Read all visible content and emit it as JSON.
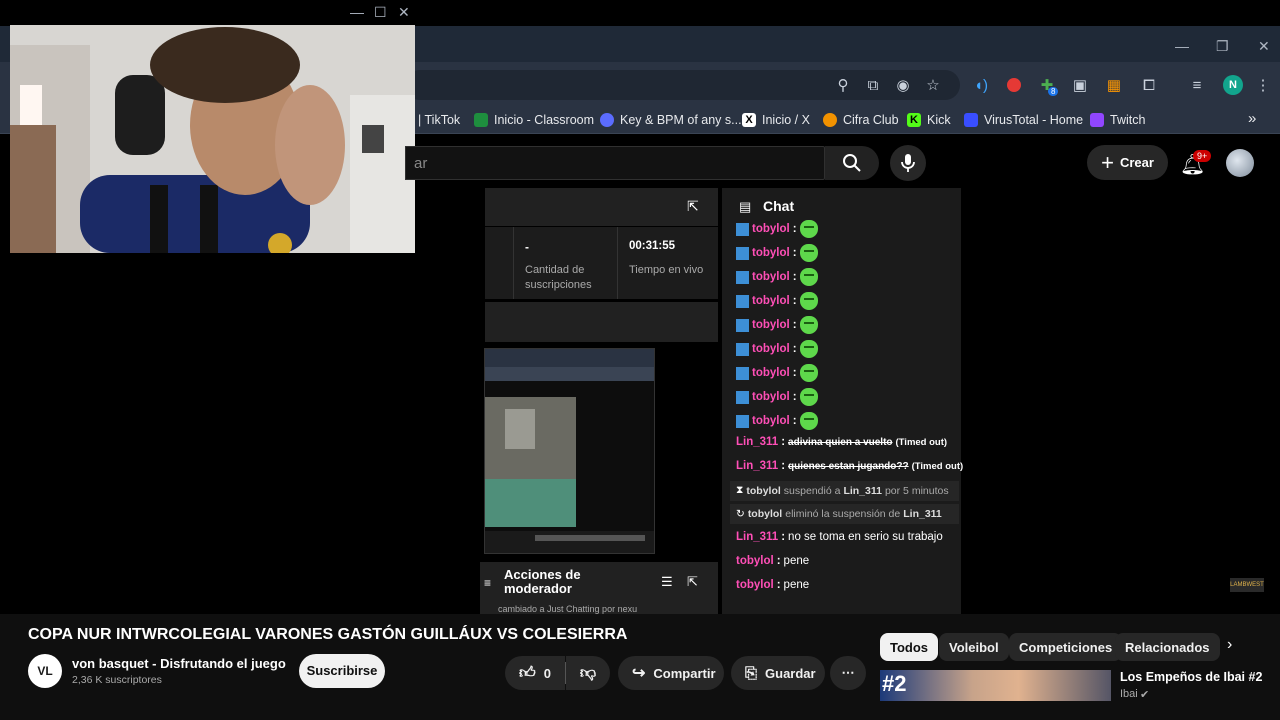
{
  "camera_window": {
    "minimize": "—",
    "maximize": "☐",
    "close": "✕"
  },
  "browser": {
    "window_controls": {
      "minimize": "—",
      "restore": "❐",
      "close": "✕"
    },
    "profile_initial": "N",
    "extension_badge": "8",
    "bookmarks": [
      {
        "label": "| TikTok",
        "color": "#ffffff00"
      },
      {
        "label": "Inicio - Classroom",
        "color": "#1e8e3e"
      },
      {
        "label": "Key & BPM of any s...",
        "color": "#5b6cff"
      },
      {
        "label": "Inicio / X",
        "color": "#000000"
      },
      {
        "label": "Cifra Club",
        "color": "#f29200"
      },
      {
        "label": "Kick",
        "color": "#53fc18"
      },
      {
        "label": "VirusTotal - Home",
        "color": "#394eff"
      },
      {
        "label": "Twitch",
        "color": "#9146ff"
      }
    ],
    "bookmarks_more": "»"
  },
  "youtube": {
    "search_placeholder": "ar",
    "create_label": "Crear",
    "notifications_badge": "9+"
  },
  "studio": {
    "subscriptions_value": "-",
    "subscriptions_label_line1": "Cantidad de",
    "subscriptions_label_line2": "suscripciones",
    "live_time_value": "00:31:55",
    "live_time_label": "Tiempo en vivo",
    "mod_actions_line1": "Acciones de",
    "mod_actions_line2": "moderador",
    "mod_actions_snippet": "cambiado a Just Chatting por nexu"
  },
  "chat": {
    "title": "Chat",
    "emote_lines": [
      {
        "user": "tobylol",
        "sep": ":"
      },
      {
        "user": "tobylol",
        "sep": ":"
      },
      {
        "user": "tobylol",
        "sep": ":"
      },
      {
        "user": "tobylol",
        "sep": ":"
      },
      {
        "user": "tobylol",
        "sep": ":"
      },
      {
        "user": "tobylol",
        "sep": ":"
      },
      {
        "user": "tobylol",
        "sep": ":"
      },
      {
        "user": "tobylol",
        "sep": ":"
      },
      {
        "user": "tobylol",
        "sep": ":"
      }
    ],
    "msg1": {
      "user": "Lin_311",
      "text": "adivina quien a vuelto",
      "tag": "(Timed out)"
    },
    "msg2": {
      "user": "Lin_311",
      "text": "quienes estan jugando??",
      "tag": "(Timed out)"
    },
    "sys1": {
      "actor": "tobylol",
      "action": "suspendió a",
      "target": "Lin_311",
      "rest": "por 5 minutos"
    },
    "sys2": {
      "actor": "tobylol",
      "action": "eliminó la suspensión de",
      "target": "Lin_311"
    },
    "msg3": {
      "user": "Lin_311",
      "text": "no se toma en serio su trabajo"
    },
    "msg4": {
      "user": "tobylol",
      "text": "pene"
    },
    "msg5": {
      "user": "tobylol",
      "text": "pene"
    }
  },
  "video": {
    "title": "COPA NUR INTWRCOLEGIAL VARONES GASTÓN GUILLÁUX VS COLESIERRA",
    "channel_name": "von basquet - Disfrutando el juego",
    "subscribers": "2,36 K suscriptores",
    "channel_avatar_text": "VL",
    "subscribe_label": "Suscribirse",
    "likes": "0",
    "share_label": "Compartir",
    "save_label": "Guardar",
    "more_label": "⋯"
  },
  "filter_chips": [
    "Todos",
    "Voleibol",
    "Competiciones",
    "Relacionados"
  ],
  "recommended": {
    "title": "Los Empeños de Ibai #2",
    "channel": "Ibai",
    "thumb_text": "#2"
  },
  "watermark": "LAMBWEST"
}
